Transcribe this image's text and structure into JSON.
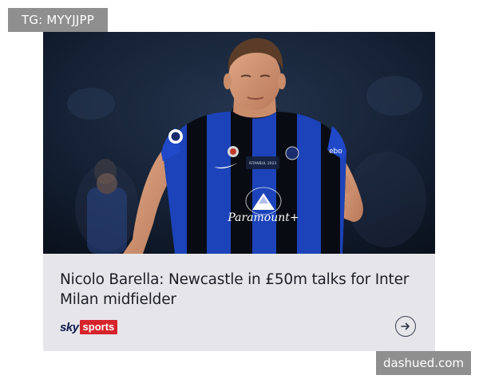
{
  "watermarks": {
    "top_left": "TG: MYYJJPP",
    "bottom_right": "dashued.com"
  },
  "card": {
    "image": {
      "subject": "player-photo",
      "kit_sponsor": "Paramount+",
      "kit_brand_sleeve": "ebo",
      "patch_text": "ISTANBUL 2023"
    },
    "headline": "Nicolo Barella: Newcastle in £50m talks for Inter Milan midfielder",
    "source": {
      "logo_sky": "sky",
      "logo_sports": "sports"
    },
    "open_icon": "arrow-right-circle-icon"
  },
  "colors": {
    "card_background": "#e6e6ea",
    "headline_text": "#1d1d26",
    "sky_blue": "#0d1b4d",
    "sports_red": "#d6232b",
    "kit_blue": "#1f49c9",
    "kit_black": "#0a0c14",
    "watermark_gray": "#8f8f8f"
  }
}
